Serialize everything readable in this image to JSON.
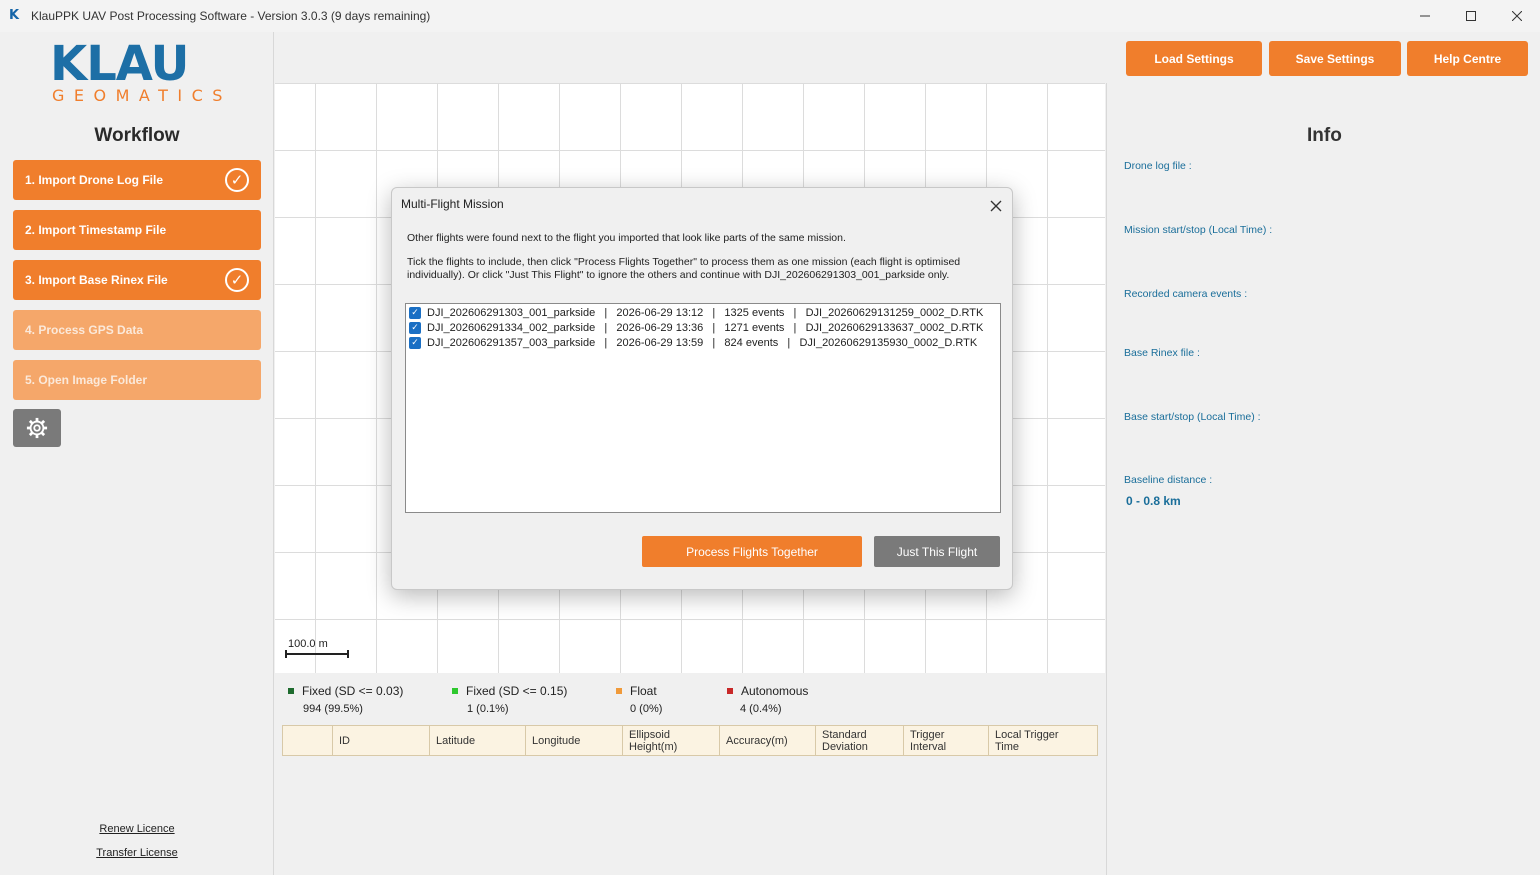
{
  "window": {
    "title": "KlauPPK UAV Post Processing Software - Version 3.0.3 (9 days remaining)",
    "app_icon": "K",
    "controls": [
      "minimize",
      "maximize",
      "close"
    ]
  },
  "logo": {
    "main": "KLAU",
    "sub": "GEOMATICS"
  },
  "sidebar": {
    "title": "Workflow",
    "steps": [
      {
        "label": "1. Import Drone Log File",
        "state": "done"
      },
      {
        "label": "2. Import Timestamp File",
        "state": "active"
      },
      {
        "label": "3. Import Base Rinex File",
        "state": "done"
      },
      {
        "label": "4. Process GPS Data",
        "state": "disabled"
      },
      {
        "label": "5. Open Image Folder",
        "state": "disabled"
      }
    ],
    "settings_icon": "gear-icon",
    "links": {
      "renew": "Renew Licence",
      "transfer": "Transfer License"
    }
  },
  "toolbar": {
    "load": "Load Settings",
    "save": "Save Settings",
    "help": "Help Centre"
  },
  "info": {
    "title": "Info",
    "drone_log": "Drone log file :",
    "mission": "Mission start/stop (Local Time) :",
    "events": "Recorded camera events :",
    "base_rinex": "Base Rinex file :",
    "base_startstop": "Base start/stop (Local Time) :",
    "baseline": "Baseline distance :",
    "baseline_value": "0 - 0.8 km"
  },
  "map": {
    "scale_label": "100.0 m"
  },
  "legend": [
    {
      "label": "Fixed (SD <= 0.03)",
      "count": "994 (99.5%)",
      "color": "#1e6b2e"
    },
    {
      "label": "Fixed (SD <= 0.15)",
      "count": "1 (0.1%)",
      "color": "#2ec82e"
    },
    {
      "label": "Float",
      "count": "0 (0%)",
      "color": "#f09a3a"
    },
    {
      "label": "Autonomous",
      "count": "4 (0.4%)",
      "color": "#c82828"
    }
  ],
  "table": {
    "columns": [
      "",
      "ID",
      "Latitude",
      "Longitude",
      "Ellipsoid\nHeight(m)",
      "Accuracy(m)",
      "Standard\nDeviation",
      "Trigger\nInterval",
      "Local Trigger\nTime"
    ]
  },
  "dialog": {
    "title": "Multi-Flight Mission",
    "intro": "Other flights were found next to the flight you imported that look like parts of the same mission.",
    "instructions": "Tick the flights to include, then click \"Process Flights Together\" to process them as one mission (each flight is optimised individually). Or click \"Just This Flight\" to ignore the others and continue with DJI_202606291303_001_parkside only.",
    "flights": [
      {
        "text": "DJI_202606291303_001_parkside   |   2026-06-29 13:12   |   1325 events   |   DJI_20260629131259_0002_D.RTK",
        "checked": true
      },
      {
        "text": "DJI_202606291334_002_parkside   |   2026-06-29 13:36   |   1271 events   |   DJI_20260629133637_0002_D.RTK",
        "checked": true
      },
      {
        "text": "DJI_202606291357_003_parkside   |   2026-06-29 13:59   |   824 events   |   DJI_20260629135930_0002_D.RTK",
        "checked": true
      }
    ],
    "process_button": "Process Flights Together",
    "just_button": "Just This Flight",
    "colors": {
      "process": "#f07e2c",
      "just": "#7a7a7a"
    }
  }
}
